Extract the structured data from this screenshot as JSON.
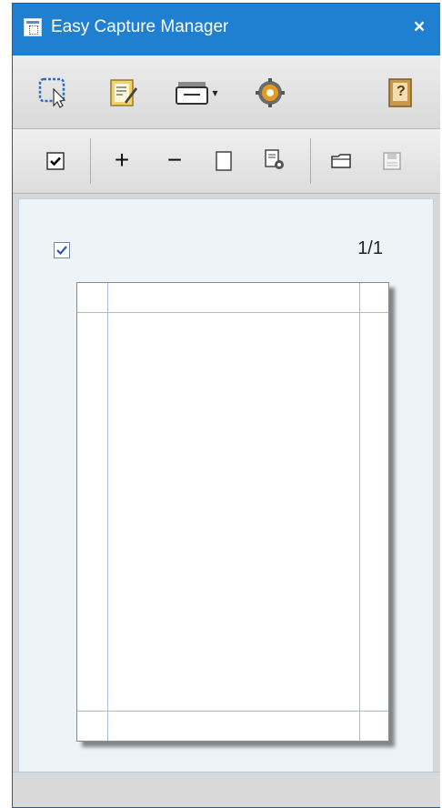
{
  "window": {
    "title": "Easy Capture Manager"
  },
  "toolbar_main": {
    "items": [
      {
        "icon": "capture-region-icon"
      },
      {
        "icon": "notepad-edit-icon"
      },
      {
        "icon": "printer-icon",
        "dropdown": "▾"
      },
      {
        "icon": "gear-icon"
      },
      {
        "icon": "help-book-icon",
        "label": "?"
      }
    ]
  },
  "toolbar_edit": {
    "select_all_checked": true,
    "add_label": "+",
    "remove_label": "−"
  },
  "preview": {
    "page_indicator": "1/1",
    "page_checked": true
  },
  "colors": {
    "titlebar": "#1f7fd0",
    "canvas": "#eef3f8",
    "margin": "#a8bbdf"
  }
}
